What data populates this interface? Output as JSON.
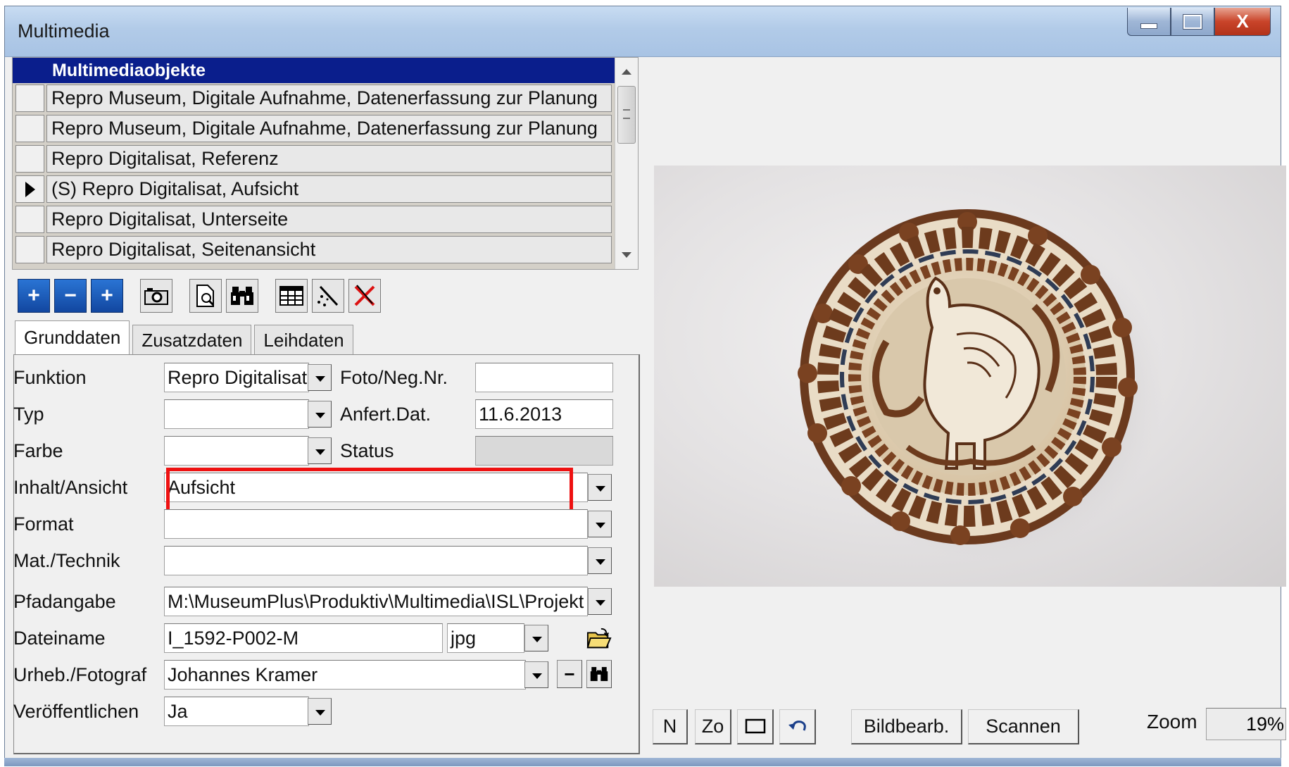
{
  "window": {
    "title": "Multimedia",
    "controls": {
      "minimize_icon": "minimize-icon",
      "maximize_icon": "maximize-icon",
      "close_label": "X"
    }
  },
  "list": {
    "header": "Multimediaobjekte",
    "rows": [
      {
        "text": "Repro Museum, Digitale Aufnahme, Datenerfassung zur Planung",
        "selected": false
      },
      {
        "text": "Repro Museum, Digitale Aufnahme, Datenerfassung zur Planung",
        "selected": false
      },
      {
        "text": "Repro Digitalisat, Referenz",
        "selected": false
      },
      {
        "text": "(S) Repro Digitalisat, Aufsicht",
        "selected": true
      },
      {
        "text": "Repro Digitalisat, Unterseite",
        "selected": false
      },
      {
        "text": "Repro Digitalisat, Seitenansicht",
        "selected": false
      }
    ]
  },
  "toolbar": {
    "icons": [
      "add-icon",
      "remove-icon",
      "add-copy-icon",
      "camera-icon",
      "document-preview-icon",
      "binoculars-icon",
      "table-icon",
      "magic-wand-icon",
      "delete-cross-icon"
    ],
    "add_label": "+",
    "remove_label": "−",
    "addcopy_label": "+"
  },
  "tabs": [
    {
      "label": "Grunddaten",
      "active": true
    },
    {
      "label": "Zusatzdaten",
      "active": false
    },
    {
      "label": "Leihdaten",
      "active": false
    }
  ],
  "form": {
    "funktion": {
      "label": "Funktion",
      "value": "Repro Digitalisat"
    },
    "foto_neg": {
      "label": "Foto/Neg.Nr.",
      "value": ""
    },
    "typ": {
      "label": "Typ",
      "value": ""
    },
    "anfert_dat": {
      "label": "Anfert.Dat.",
      "value": "11.6.2013"
    },
    "farbe": {
      "label": "Farbe",
      "value": ""
    },
    "status": {
      "label": "Status",
      "value": ""
    },
    "inhalt": {
      "label": "Inhalt/Ansicht",
      "value": "Aufsicht"
    },
    "format": {
      "label": "Format",
      "value": ""
    },
    "mat_technik": {
      "label": "Mat./Technik",
      "value": ""
    },
    "pfad": {
      "label": "Pfadangabe",
      "value": "M:\\MuseumPlus\\Produktiv\\Multimedia\\ISL\\Projekt"
    },
    "dateiname": {
      "label": "Dateiname",
      "value": "I_1592-P002-M",
      "ext": "jpg"
    },
    "urheber": {
      "label": "Urheb./Fotograf",
      "value": "Johannes Kramer",
      "minus_label": "−"
    },
    "veroeffentlichen": {
      "label": "Veröffentlichen",
      "value": "Ja"
    }
  },
  "viewer": {
    "buttons": {
      "n": "N",
      "zo": "Zo",
      "bildbearb": "Bildbearb.",
      "scannen": "Scannen"
    },
    "zoom_label": "Zoom",
    "zoom_value": "19%",
    "image_icon": "lustreware-plate-image"
  },
  "colors": {
    "list_header_bg": "#0a1e8c",
    "highlight_border": "#ee1111",
    "title_bar": "#b2cbe8"
  }
}
